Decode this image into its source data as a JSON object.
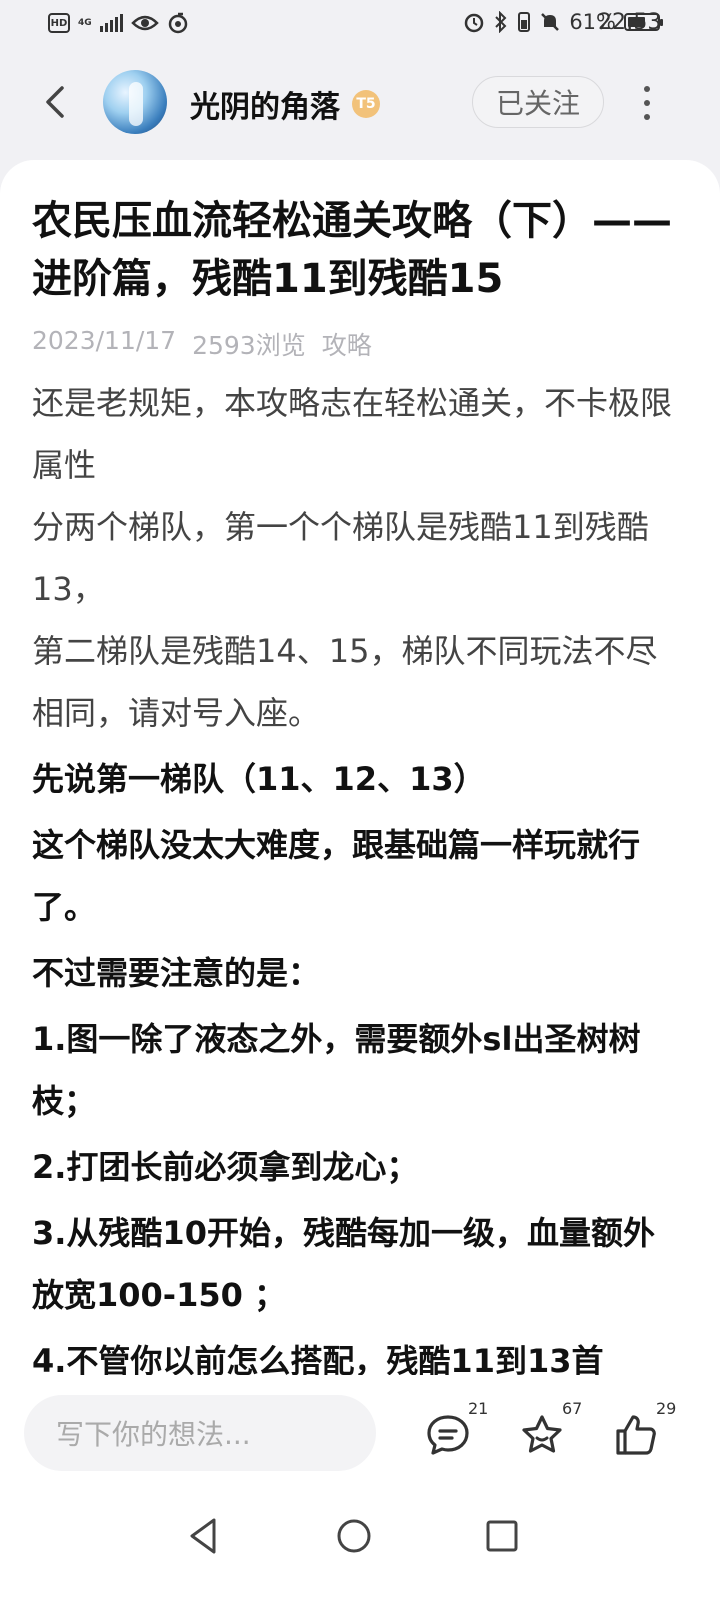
{
  "status_bar": {
    "hd": "HD",
    "network": "4G",
    "battery_level": "61%",
    "battery_fraction": 0.61,
    "time": "22:53",
    "icons": [
      "eye-icon",
      "sync-icon",
      "alarm-icon",
      "bluetooth-icon",
      "mute-icon",
      "battery-icon"
    ]
  },
  "header": {
    "username": "光阴的角落",
    "level_badge": "T5",
    "follow_label": "已关注"
  },
  "post": {
    "title": "农民压血流轻松通关攻略（下）——进阶篇，残酷11到残酷15",
    "date": "2023/11/17",
    "views": "2593浏览",
    "category": "攻略",
    "paragraphs": [
      {
        "text": "还是老规矩，本攻略志在轻松通关，不卡极限属性",
        "bold": false
      },
      {
        "text": "分两个梯队，第一个个梯队是残酷11到残酷13，",
        "bold": false
      },
      {
        "text": "第二梯队是残酷14、15，梯队不同玩法不尽相同，请对号入座。",
        "bold": false
      },
      {
        "text": "先说第一梯队（11、12、13）",
        "bold": true
      },
      {
        "text": "这个梯队没太大难度，跟基础篇一样玩就行了。",
        "bold": true
      },
      {
        "text": "不过需要注意的是：",
        "bold": true
      },
      {
        "text": "1.图一除了液态之外，需要额外sl出圣树树枝；",
        "bold": true
      },
      {
        "text": "2.打团长前必须拿到龙心；",
        "bold": true
      },
      {
        "text": "3.从残酷10开始，残酷每加一级，血量额外放宽100-150 ；",
        "bold": true
      },
      {
        "text": "4.不管你以前怎么搭配，残酷11到13首",
        "bold": true
      }
    ]
  },
  "actions": {
    "comment_placeholder": "写下你的想法...",
    "comments": "21",
    "favorites": "67",
    "likes": "29"
  }
}
